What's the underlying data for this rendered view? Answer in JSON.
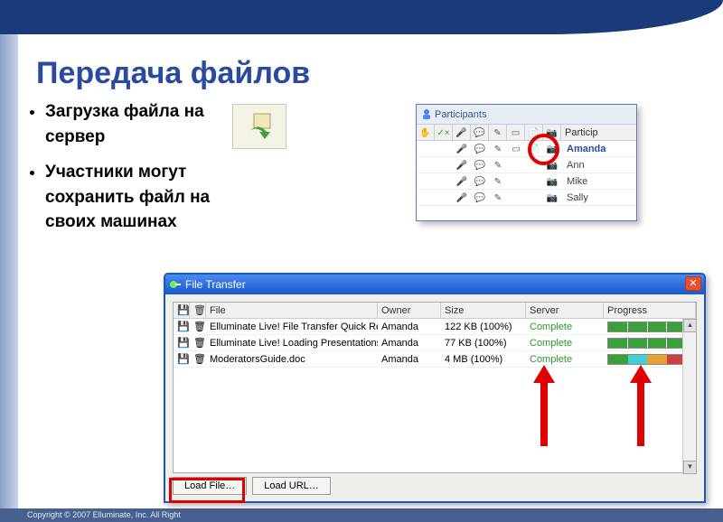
{
  "slide": {
    "title": "Передача файлов",
    "bullets": [
      "Загрузка файла на сервер",
      "Участники могут сохранить файл на своих машинах"
    ],
    "footer": "Copyright © 2007 Elluminate, Inc. All Right"
  },
  "participants_panel": {
    "title": "Participants",
    "header_label": "Particip",
    "rows": [
      {
        "name": "Amanda",
        "bold": true
      },
      {
        "name": "Ann",
        "bold": false
      },
      {
        "name": "Mike",
        "bold": false
      },
      {
        "name": "Sally",
        "bold": false
      }
    ]
  },
  "file_transfer": {
    "window_title": "File Transfer",
    "columns": {
      "file": "File",
      "owner": "Owner",
      "size": "Size",
      "server": "Server",
      "progress": "Progress"
    },
    "rows": [
      {
        "file": "Elluminate Live! File Transfer Quick Re…",
        "owner": "Amanda",
        "size": "122 KB (100%)",
        "server": "Complete",
        "progress": [
          "g",
          "g",
          "g",
          "g"
        ]
      },
      {
        "file": "Elluminate Live! Loading Presentations…",
        "owner": "Amanda",
        "size": "77 KB (100%)",
        "server": "Complete",
        "progress": [
          "g",
          "g",
          "g",
          "g"
        ]
      },
      {
        "file": "ModeratorsGuide.doc",
        "owner": "Amanda",
        "size": "4 MB (100%)",
        "server": "Complete",
        "progress": [
          "g",
          "c",
          "o",
          "r"
        ]
      }
    ],
    "buttons": {
      "load_file": "Load File…",
      "load_url": "Load URL…"
    }
  }
}
